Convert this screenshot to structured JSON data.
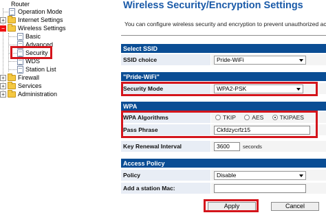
{
  "tree": {
    "root": "Router",
    "items": [
      {
        "label": "Operation Mode"
      },
      {
        "label": "Internet Settings"
      },
      {
        "label": "Wireless Settings"
      },
      {
        "label": "Basic"
      },
      {
        "label": "Advanced"
      },
      {
        "label": "Security"
      },
      {
        "label": "WDS"
      },
      {
        "label": "Station List"
      },
      {
        "label": "Firewall"
      },
      {
        "label": "Services"
      },
      {
        "label": "Administration"
      }
    ],
    "expander_plus": "+",
    "expander_minus": "−"
  },
  "page": {
    "title": "Wireless Security/Encryption Settings",
    "description": "You can configure wireless security and encryption to prevent unauthorized acces"
  },
  "sections": {
    "select_ssid": {
      "header": "Select SSID",
      "ssid_choice_label": "SSID choice",
      "ssid_choice_value": "Pride-WiFi"
    },
    "ssid": {
      "header": "\"Pride-WiFi\"",
      "security_mode_label": "Security Mode",
      "security_mode_value": "WPA2-PSK"
    },
    "wpa": {
      "header": "WPA",
      "algorithms_label": "WPA Algorithms",
      "algorithms": [
        {
          "label": "TKIP",
          "checked": false
        },
        {
          "label": "AES",
          "checked": false
        },
        {
          "label": "TKIPAES",
          "checked": true
        }
      ],
      "pass_phrase_label": "Pass Phrase",
      "pass_phrase_value": "Ckfdzycrfz15",
      "key_renewal_label": "Key Renewal Interval",
      "key_renewal_value": "3600",
      "key_renewal_unit": "seconds"
    },
    "access_policy": {
      "header": "Access Policy",
      "policy_label": "Policy",
      "policy_value": "Disable",
      "add_mac_label": "Add a station Mac:",
      "add_mac_value": ""
    }
  },
  "buttons": {
    "apply": "Apply",
    "cancel": "Cancel"
  },
  "colors": {
    "section_header": "#0a4d94",
    "title": "#1a5aa8",
    "highlight": "#d4141b"
  }
}
